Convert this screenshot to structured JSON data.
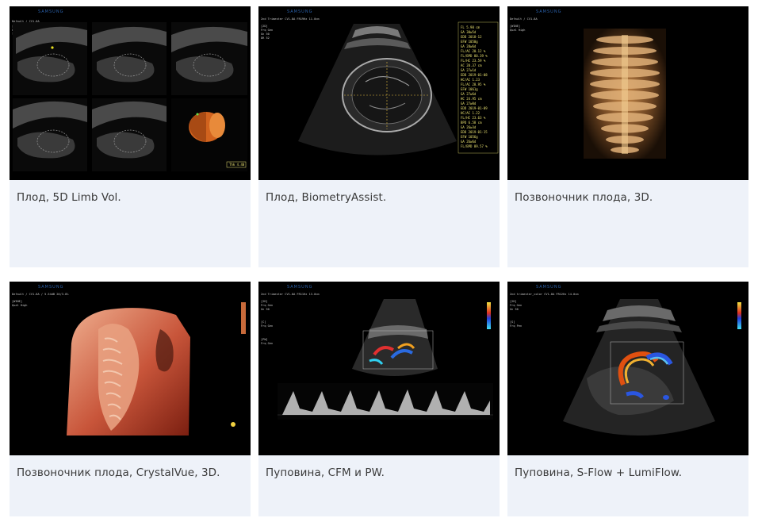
{
  "brand": "SAMSUNG",
  "cards": [
    {
      "caption": "Плод, 5D Limb Vol.",
      "image": "fetus-5d-limb-volume-ultrasound"
    },
    {
      "caption": "Плод, BiometryAssist.",
      "image": "fetus-biometry-assist-ultrasound"
    },
    {
      "caption": "Позвоночник плода, 3D.",
      "image": "fetal-spine-3d-ultrasound"
    },
    {
      "caption": "Позвоночник плода, CrystalVue, 3D.",
      "image": "fetal-spine-crystalvue-3d-ultrasound"
    },
    {
      "caption": "Пуповина, CFM и PW.",
      "image": "umbilical-cord-cfm-pw-ultrasound"
    },
    {
      "caption": "Пуповина, S-Flow + LumiFlow.",
      "image": "umbilical-cord-sflow-lumiflow-ultrasound"
    }
  ],
  "colors": {
    "card_bg": "#eef2f9",
    "caption_text": "#3a3a3a",
    "image_bg": "#000000",
    "brand_blue": "#2a5fa8"
  }
}
